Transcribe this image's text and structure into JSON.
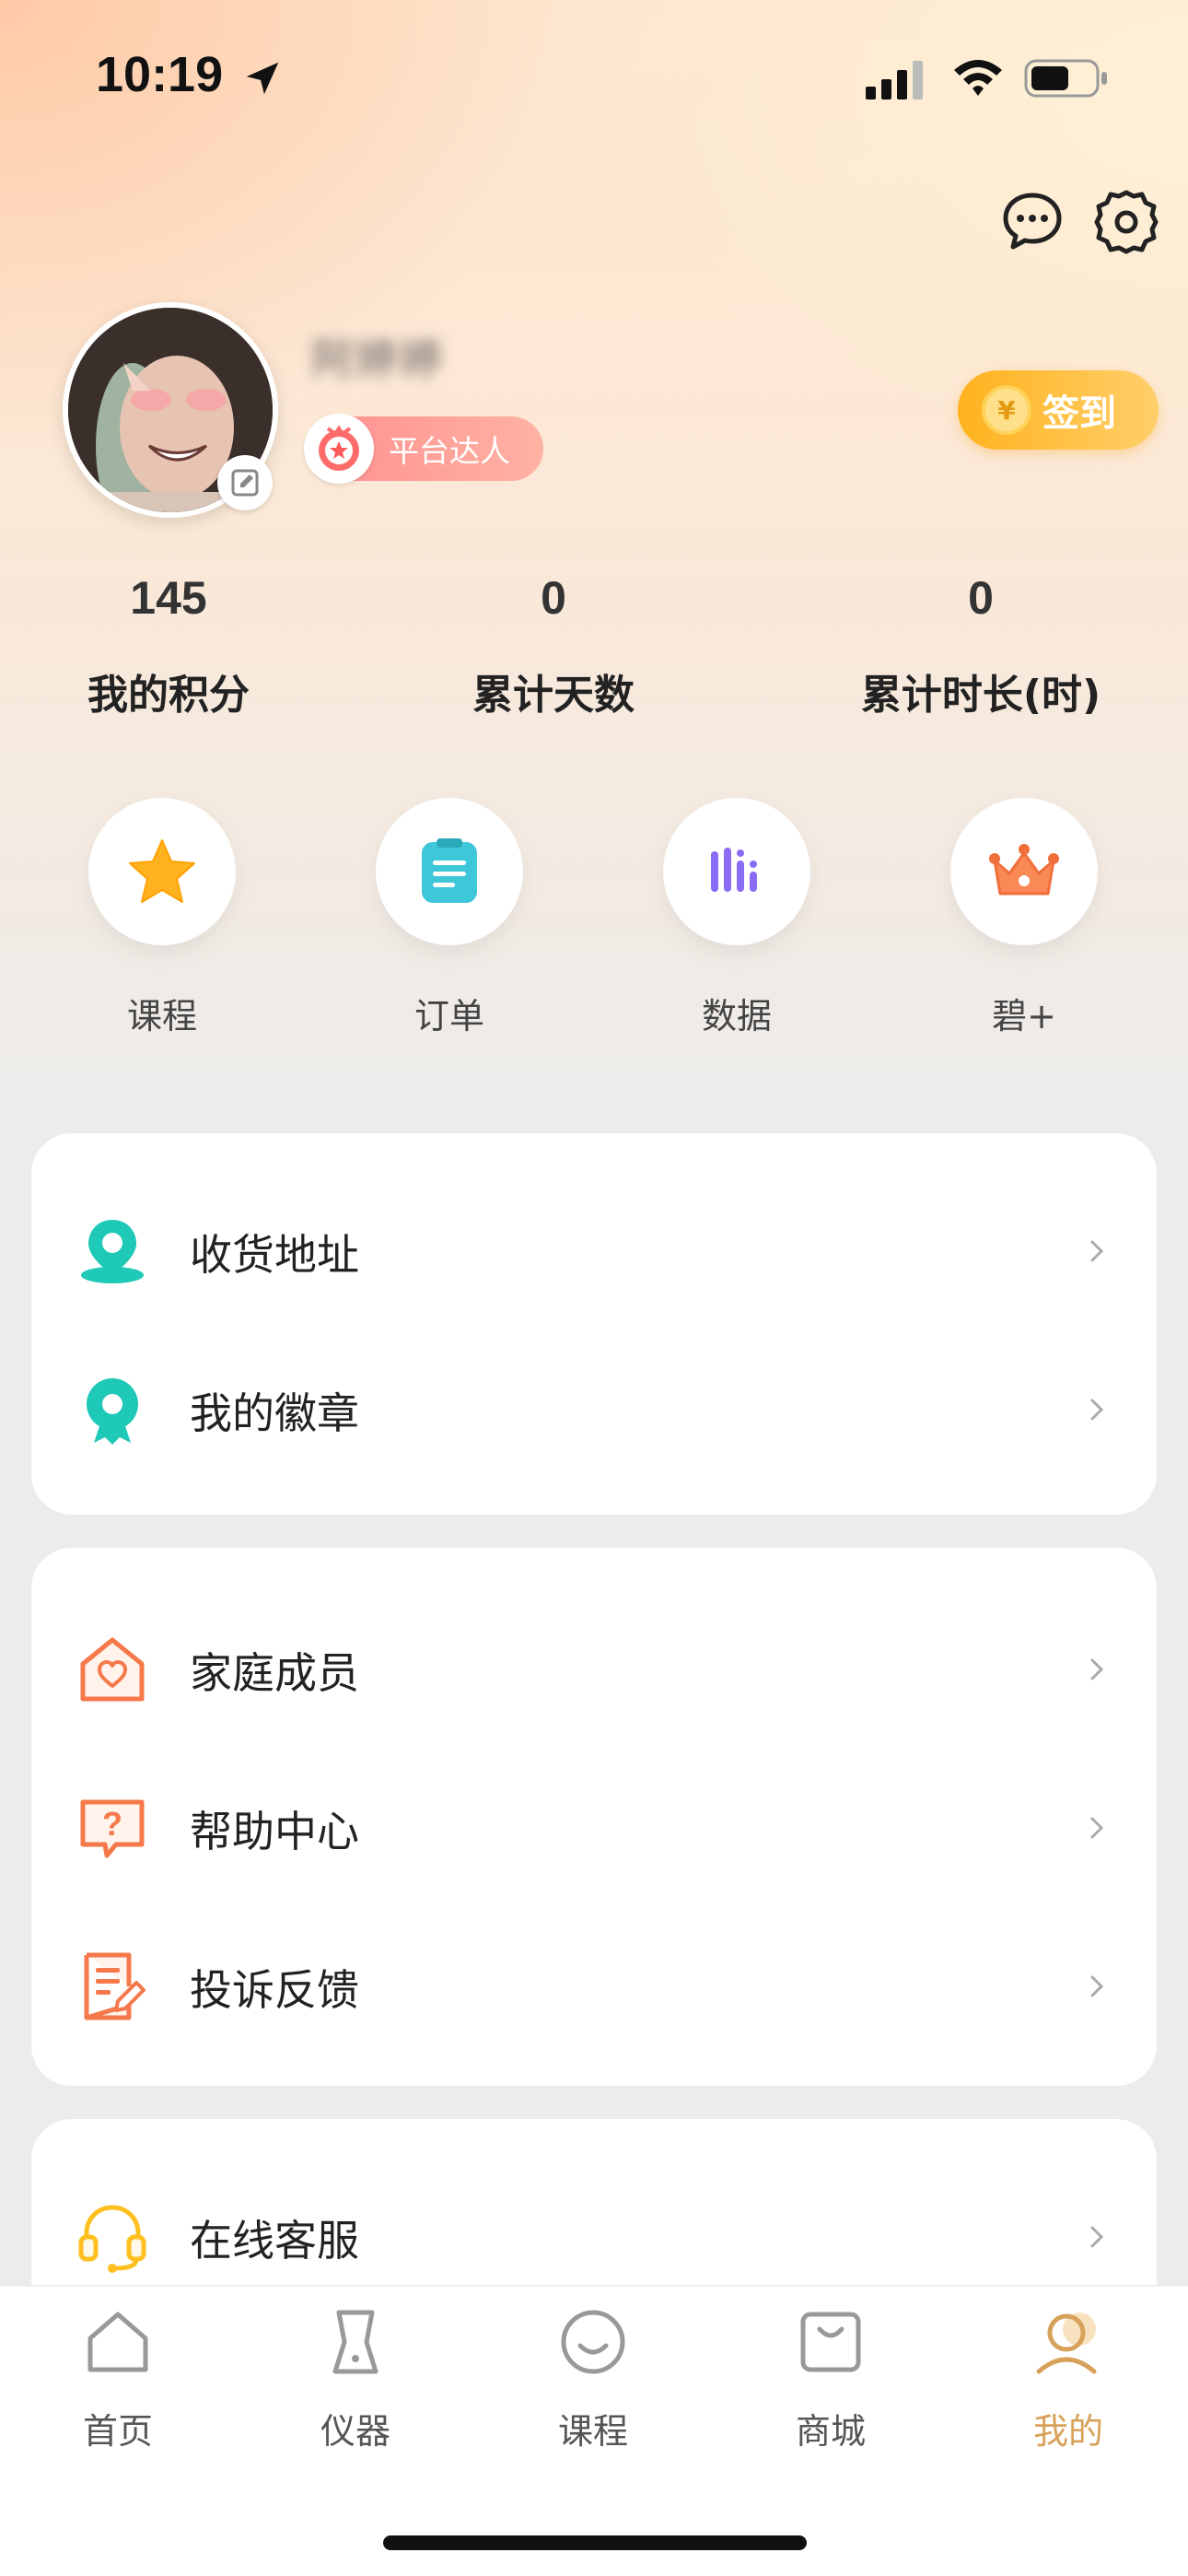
{
  "status": {
    "time": "10:19"
  },
  "profile": {
    "username": "阿婷婷",
    "badge": "平台达人",
    "checkin_label": "签到",
    "coin_symbol": "¥"
  },
  "stats": [
    {
      "value": "145",
      "label": "我的积分"
    },
    {
      "value": "0",
      "label": "累计天数"
    },
    {
      "value": "0",
      "label": "累计时长(时)"
    }
  ],
  "quick_actions": [
    {
      "label": "课程",
      "icon": "star-icon"
    },
    {
      "label": "订单",
      "icon": "clipboard-icon"
    },
    {
      "label": "数据",
      "icon": "bars-icon"
    },
    {
      "label": "碧+",
      "icon": "crown-icon"
    }
  ],
  "menu": {
    "card1": [
      {
        "label": "收货地址",
        "icon": "location-pin-icon"
      },
      {
        "label": "我的徽章",
        "icon": "medal-icon"
      }
    ],
    "card2": [
      {
        "label": "家庭成员",
        "icon": "house-heart-icon"
      },
      {
        "label": "帮助中心",
        "icon": "help-bubble-icon"
      },
      {
        "label": "投诉反馈",
        "icon": "feedback-doc-icon"
      }
    ],
    "card3": [
      {
        "label": "在线客服",
        "icon": "headset-icon"
      }
    ]
  },
  "tabs": [
    {
      "label": "首页",
      "icon": "home-icon"
    },
    {
      "label": "仪器",
      "icon": "device-icon"
    },
    {
      "label": "课程",
      "icon": "smile-icon"
    },
    {
      "label": "商城",
      "icon": "shopping-bag-icon"
    },
    {
      "label": "我的",
      "icon": "profile-icon",
      "active": true
    }
  ],
  "colors": {
    "accent_teal": "#1ec9b7",
    "accent_orange": "#f5794a",
    "accent_gold": "#d8a15a",
    "checkin": "#ffb21e"
  }
}
